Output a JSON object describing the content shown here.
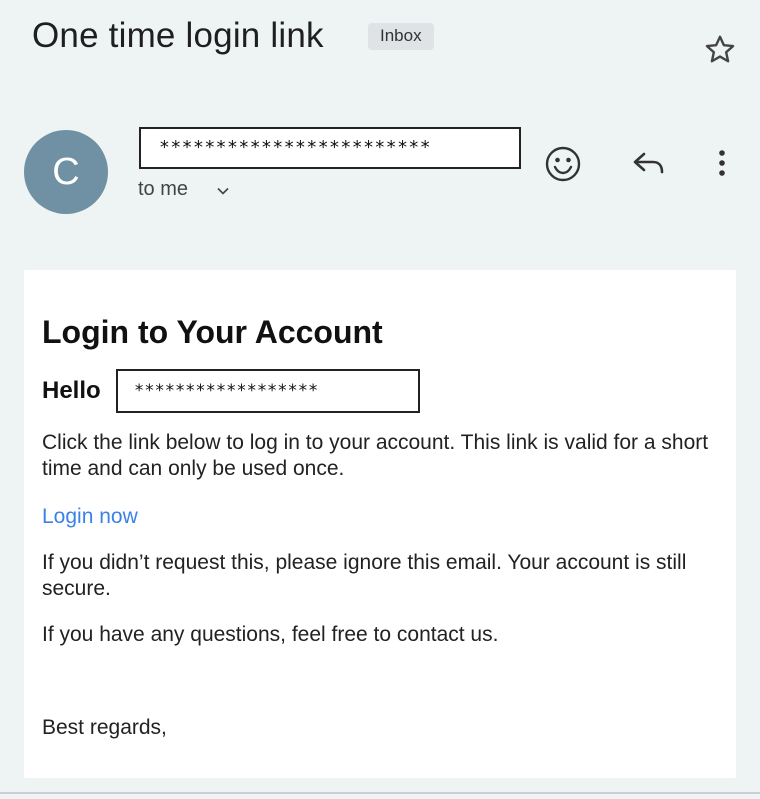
{
  "email": {
    "subject": "One time login link",
    "label": "Inbox",
    "sender_initial": "C",
    "sender_masked": "************************",
    "recipient_label": "to me"
  },
  "body": {
    "title": "Login to Your Account",
    "greeting": "Hello",
    "recipient_masked": "******************",
    "paragraph1": "Click the link below to log in to your account. This link is valid for a short time and can only be used once.",
    "link_text": "Login now",
    "paragraph2": "If you didn’t request this, please ignore this email. Your account is still secure.",
    "paragraph3": "If you have any questions, feel free to contact us.",
    "closing": "Best regards,"
  },
  "icons": {
    "star": "star-icon",
    "emoji": "emoji-reaction-icon",
    "reply": "reply-icon",
    "more": "more-vertical-icon",
    "chevron": "chevron-down-icon"
  },
  "colors": {
    "background": "#eef3f4",
    "avatar": "#7090a3",
    "link": "#3b82e6"
  }
}
